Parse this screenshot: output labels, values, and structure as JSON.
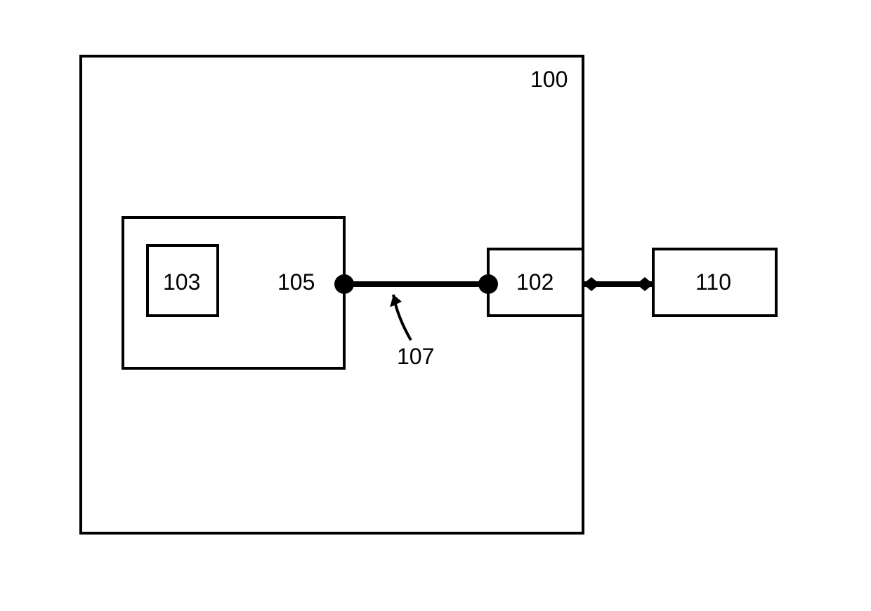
{
  "labels": {
    "outerBox": "100",
    "middleBox": "105",
    "innerBox": "103",
    "rightBox": "102",
    "externalBox": "110",
    "connector": "107"
  }
}
